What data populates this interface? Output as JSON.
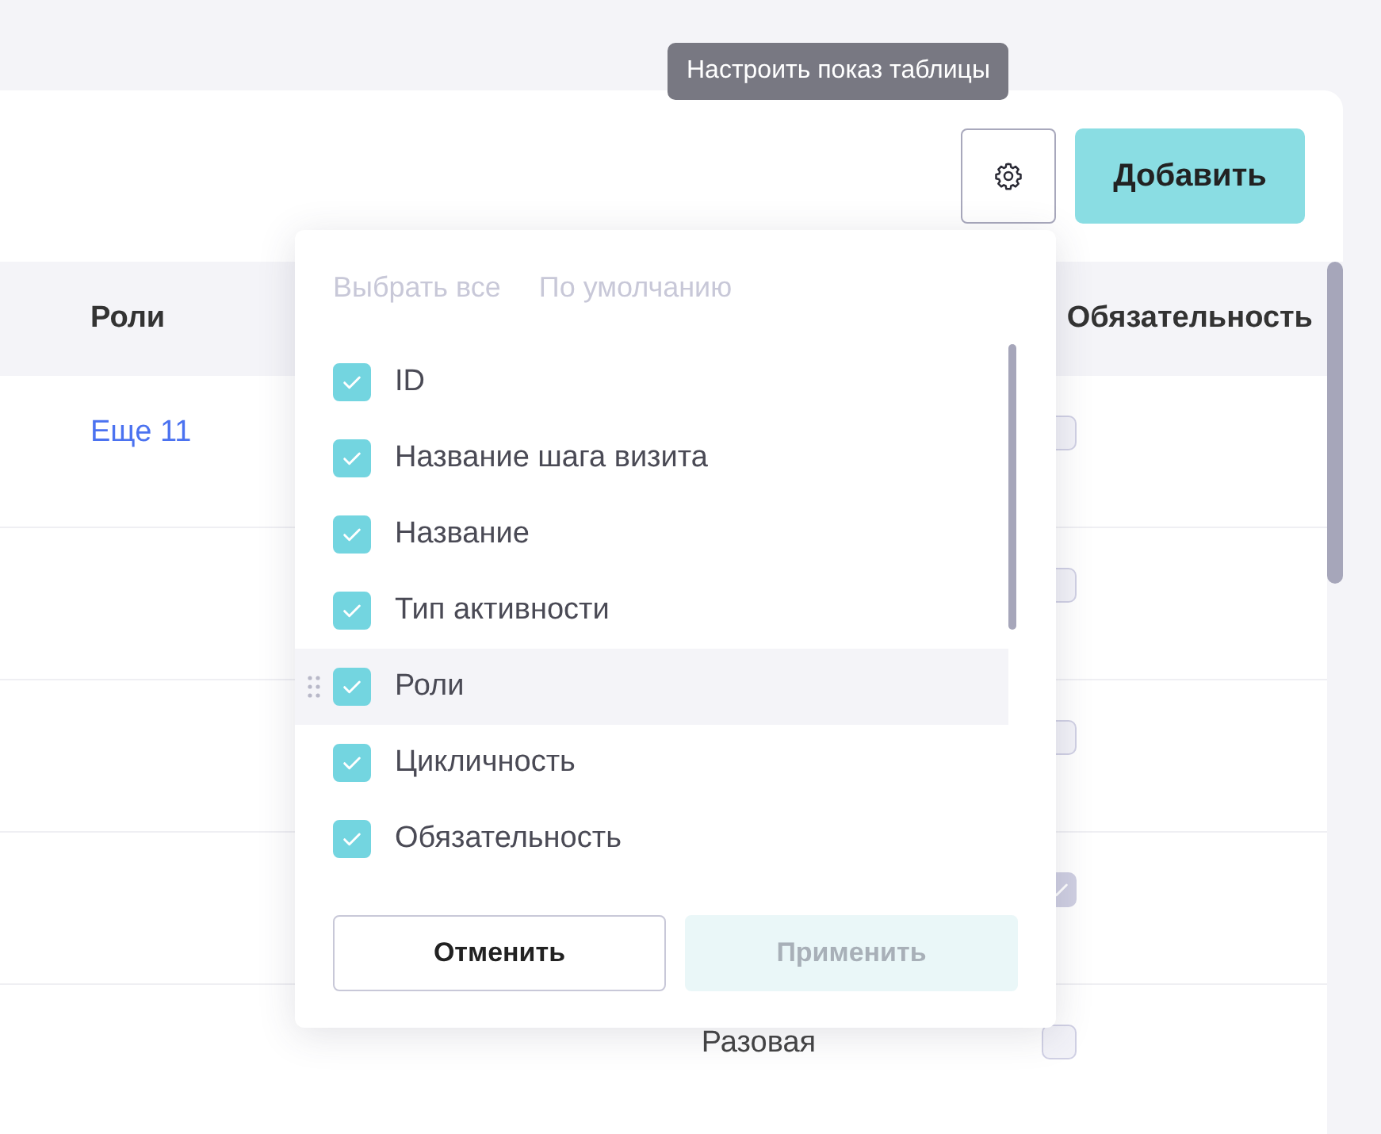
{
  "tooltip": {
    "text": "Настроить показ таблицы"
  },
  "toolbar": {
    "add_button": {
      "label": "Добавить"
    }
  },
  "table": {
    "columns": [
      {
        "label": "Роли"
      },
      {
        "label": "Обязательность"
      }
    ],
    "rows": [
      {
        "roles": "Еще 11",
        "mandatory": false
      },
      {
        "mandatory": false
      },
      {
        "mandatory": false
      },
      {
        "mandatory": true
      },
      {
        "column_3": "Разовая",
        "mandatory": false
      }
    ]
  },
  "column_settings": {
    "actions": [
      "Выбрать все",
      "По умолчанию"
    ],
    "items": [
      {
        "label": "ID",
        "checked": true,
        "hovered": false
      },
      {
        "label": "Название шага визита",
        "checked": true,
        "hovered": false
      },
      {
        "label": "Название",
        "checked": true,
        "hovered": false
      },
      {
        "label": "Тип активности",
        "checked": true,
        "hovered": false
      },
      {
        "label": "Роли",
        "checked": true,
        "hovered": true
      },
      {
        "label": "Цикличность",
        "checked": true,
        "hovered": false
      },
      {
        "label": "Обязательность",
        "checked": true,
        "hovered": false
      }
    ],
    "cancel_button": {
      "label": "Отменить",
      "disabled": false
    },
    "apply_button": {
      "label": "Применить",
      "disabled": true
    }
  }
}
